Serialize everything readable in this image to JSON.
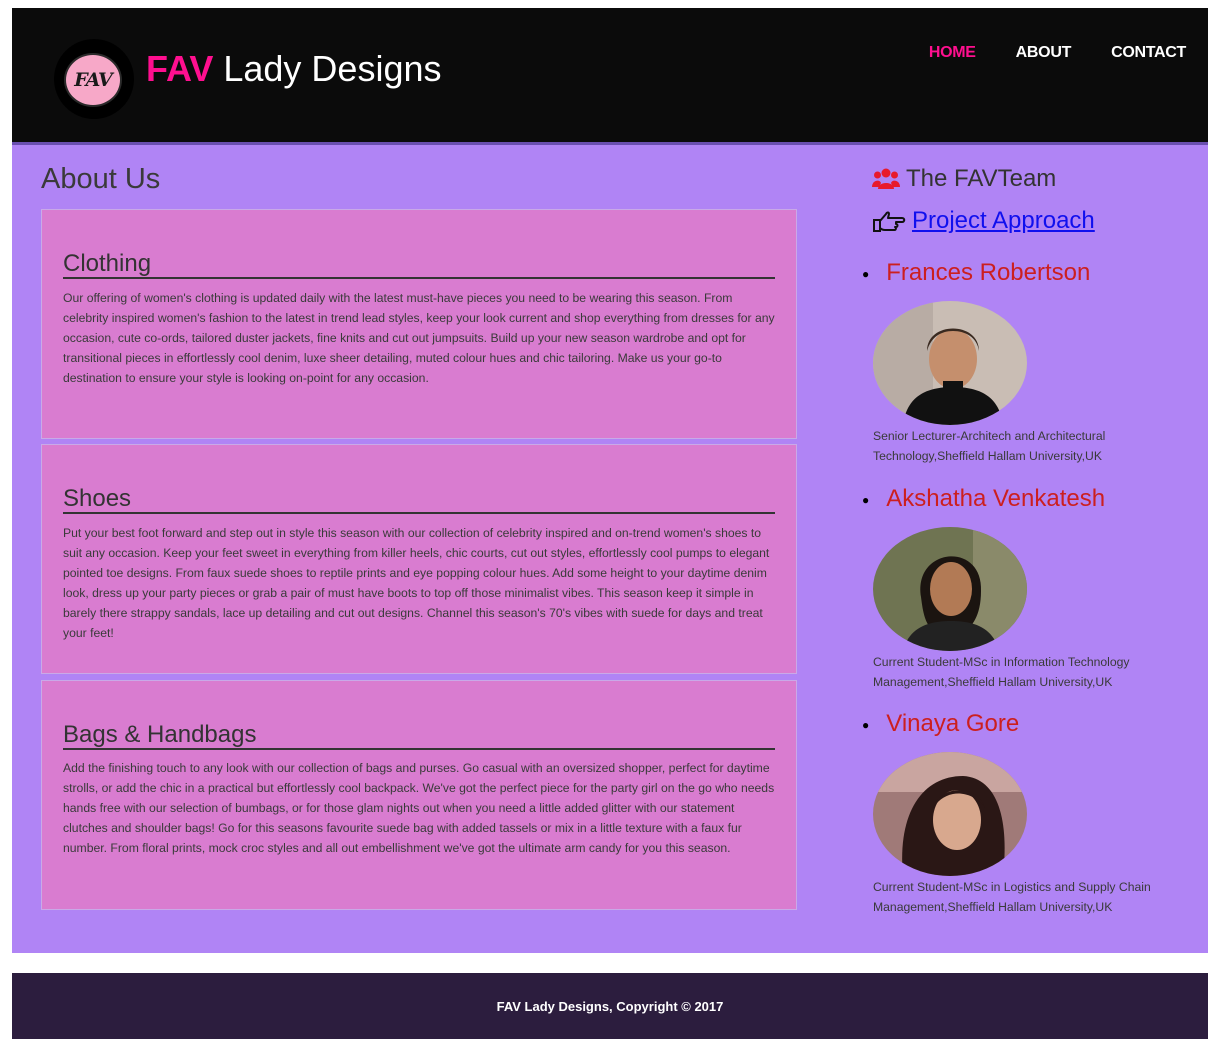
{
  "header": {
    "logo_text": "FAV",
    "brand_accent": "FAV",
    "brand_rest": "Lady Designs",
    "nav": [
      {
        "label": "HOME",
        "active": true
      },
      {
        "label": "ABOUT",
        "active": false
      },
      {
        "label": "CONTACT",
        "active": false
      }
    ]
  },
  "main": {
    "title": "About Us",
    "sections": [
      {
        "heading": "Clothing",
        "body": "Our offering of women's clothing is updated daily with the latest must-have pieces you need to be wearing this season. From celebrity inspired women's fashion to the latest in trend lead styles, keep your look current and shop everything from dresses for any occasion, cute co-ords, tailored duster jackets, fine knits and cut out jumpsuits. Build up your new season wardrobe and opt for transitional pieces in effortlessly cool denim, luxe sheer detailing, muted colour hues and chic tailoring. Make us your go-to destination to ensure your style is looking on-point for any occasion."
      },
      {
        "heading": "Shoes",
        "body": "Put your best foot forward and step out in style this season with our collection of celebrity inspired and on-trend women's shoes to suit any occasion. Keep your feet sweet in everything from killer heels, chic courts, cut out styles, effortlessly cool pumps to elegant pointed toe designs. From faux suede shoes to reptile prints and eye popping colour hues. Add some height to your daytime denim look, dress up your party pieces or grab a pair of must have boots to top off those minimalist vibes. This season keep it simple in barely there strappy sandals, lace up detailing and cut out designs. Channel this season's 70's vibes with suede for days and treat your feet!"
      },
      {
        "heading": "Bags & Handbags",
        "body": "Add the finishing touch to any look with our collection of bags and purses. Go casual with an oversized shopper, perfect for daytime strolls, or add the chic in a practical but effortlessly cool backpack. We've got the perfect piece for the party girl on the go who needs hands free with our selection of bumbags, or for those glam nights out when you need a little added glitter with our statement clutches and shoulder bags! Go for this seasons favourite suede bag with added tassels or mix in a little texture with a faux fur number. From floral prints, mock croc styles and all out embellishment we've got the ultimate arm candy for you this season."
      }
    ]
  },
  "sidebar": {
    "team_heading": "The FAVTeam",
    "approach_link": "Project Approach",
    "members": [
      {
        "name": "Frances Robertson",
        "desc": "Senior Lecturer-Architech and Architectural Technology,Sheffield Hallam University,UK"
      },
      {
        "name": "Akshatha Venkatesh",
        "desc": "Current Student-MSc in Information Technology Management,Sheffield Hallam University,UK"
      },
      {
        "name": "Vinaya Gore",
        "desc": "Current Student-MSc in Logistics and Supply Chain Management,Sheffield Hallam University,UK"
      }
    ]
  },
  "footer": {
    "text": "FAV Lady Designs, Copyright © 2017"
  },
  "colors": {
    "header_bg": "#0b0b0b",
    "accent_pink": "#ff0f8f",
    "content_bg": "#b084f5",
    "panel_bg": "#d97cd0",
    "member_name": "#cc1f1f",
    "link_blue": "#1010ee",
    "footer_bg": "#2c1d3e"
  },
  "icons": [
    "users-icon",
    "hand-point-right-icon"
  ]
}
